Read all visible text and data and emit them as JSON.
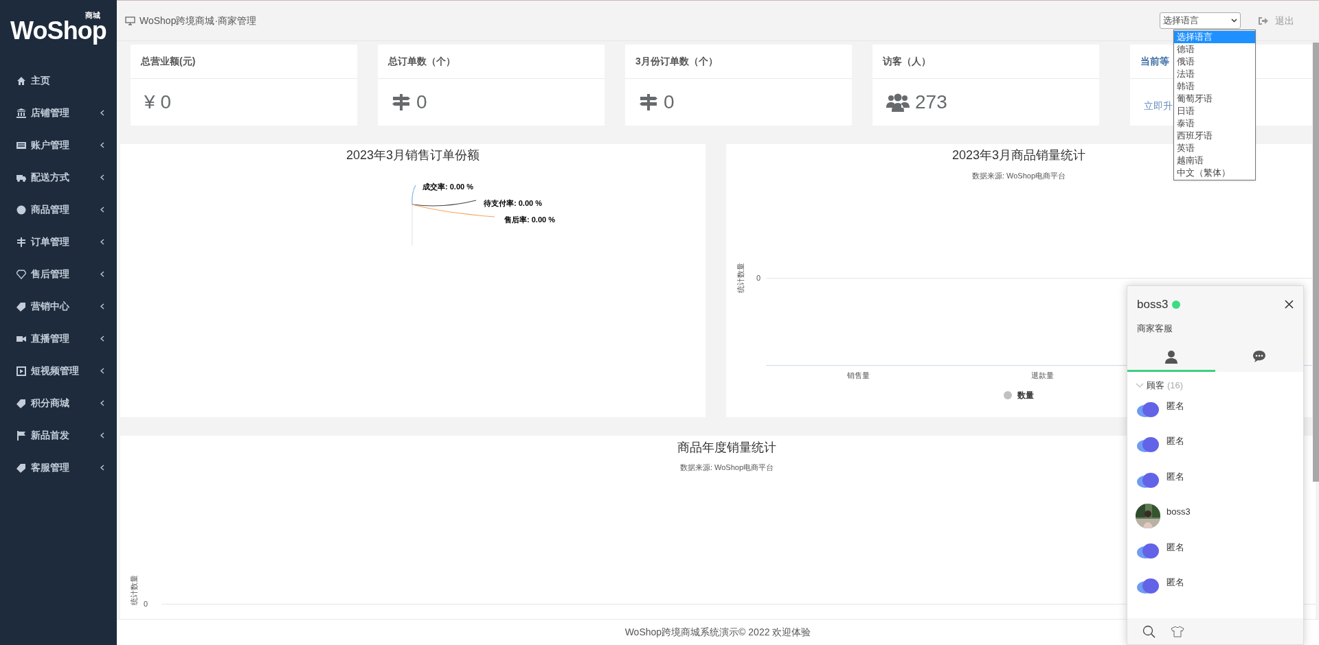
{
  "logo": {
    "text": "WoShop",
    "badge": "商城"
  },
  "sidebar": {
    "items": [
      {
        "label": "主页",
        "has_submenu": false
      },
      {
        "label": "店铺管理",
        "has_submenu": true
      },
      {
        "label": "账户管理",
        "has_submenu": true
      },
      {
        "label": "配送方式",
        "has_submenu": true
      },
      {
        "label": "商品管理",
        "has_submenu": true
      },
      {
        "label": "订单管理",
        "has_submenu": true
      },
      {
        "label": "售后管理",
        "has_submenu": true
      },
      {
        "label": "营销中心",
        "has_submenu": true
      },
      {
        "label": "直播管理",
        "has_submenu": true
      },
      {
        "label": "短视频管理",
        "has_submenu": true
      },
      {
        "label": "积分商城",
        "has_submenu": true
      },
      {
        "label": "新品首发",
        "has_submenu": true
      },
      {
        "label": "客服管理",
        "has_submenu": true
      }
    ]
  },
  "header": {
    "title": "WoShop跨境商城·商家管理",
    "logout": "退出"
  },
  "language_select": {
    "value": "选择语言",
    "expanded": true,
    "options": [
      {
        "label": "选择语言",
        "selected": true
      },
      {
        "label": "德语",
        "selected": false
      },
      {
        "label": "俄语",
        "selected": false
      },
      {
        "label": "法语",
        "selected": false
      },
      {
        "label": "韩语",
        "selected": false
      },
      {
        "label": "葡萄牙语",
        "selected": false
      },
      {
        "label": "日语",
        "selected": false
      },
      {
        "label": "泰语",
        "selected": false
      },
      {
        "label": "西班牙语",
        "selected": false
      },
      {
        "label": "英语",
        "selected": false
      },
      {
        "label": "越南语",
        "selected": false
      },
      {
        "label": "中文（繁体）",
        "selected": false
      }
    ]
  },
  "stat_cards": [
    {
      "kind": "money",
      "title": "总营业额(元)",
      "symbol": "¥",
      "value": "0"
    },
    {
      "kind": "orders",
      "title": "总订单数（个）",
      "value": "0"
    },
    {
      "kind": "orders",
      "title": "3月份订单数（个）",
      "value": "0"
    },
    {
      "kind": "visitors",
      "title": "访客（人）",
      "value": "273"
    },
    {
      "kind": "level",
      "title": "当前等",
      "link": "立即升"
    }
  ],
  "order_share_chart": {
    "title": "2023年3月销售订单份额",
    "data_labels": [
      {
        "text": "成交率: 0.00 %",
        "color": "#7cb5ec"
      },
      {
        "text": "待支付率: 0.00 %",
        "color": "#434348"
      },
      {
        "text": "售后率: 0.00 %",
        "color": "#f7a35c"
      }
    ]
  },
  "sales_chart": {
    "title": "2023年3月商品销量统计",
    "subtitle": "数据来源: WoShop电商平台",
    "ylabel": "统计数量",
    "y_tick": "0",
    "categories": [
      "销售量",
      "退款量"
    ],
    "legend": {
      "name": "数量",
      "color": "#c0c0c0"
    }
  },
  "annual_chart": {
    "title": "商品年度销量统计",
    "subtitle": "数据来源: WoShop电商平台",
    "ylabel": "统计数量",
    "y_tick": "0"
  },
  "footer": "WoShop跨境商城系统演示© 2022 欢迎体验",
  "chat_panel": {
    "user": "boss3",
    "online": true,
    "role": "商家客服",
    "tabs": [
      {
        "kind": "contacts",
        "selected": true
      },
      {
        "kind": "chats",
        "selected": false
      }
    ],
    "group": {
      "label": "顾客",
      "count": "(16)",
      "expanded": true,
      "contacts": [
        {
          "name": "匿名",
          "kind": "logo"
        },
        {
          "name": "匿名",
          "kind": "logo"
        },
        {
          "name": "匿名",
          "kind": "logo"
        },
        {
          "name": "boss3"
        },
        {
          "name": "匿名",
          "kind": "logo"
        },
        {
          "name": "匿名",
          "kind": "logo"
        }
      ]
    }
  }
}
